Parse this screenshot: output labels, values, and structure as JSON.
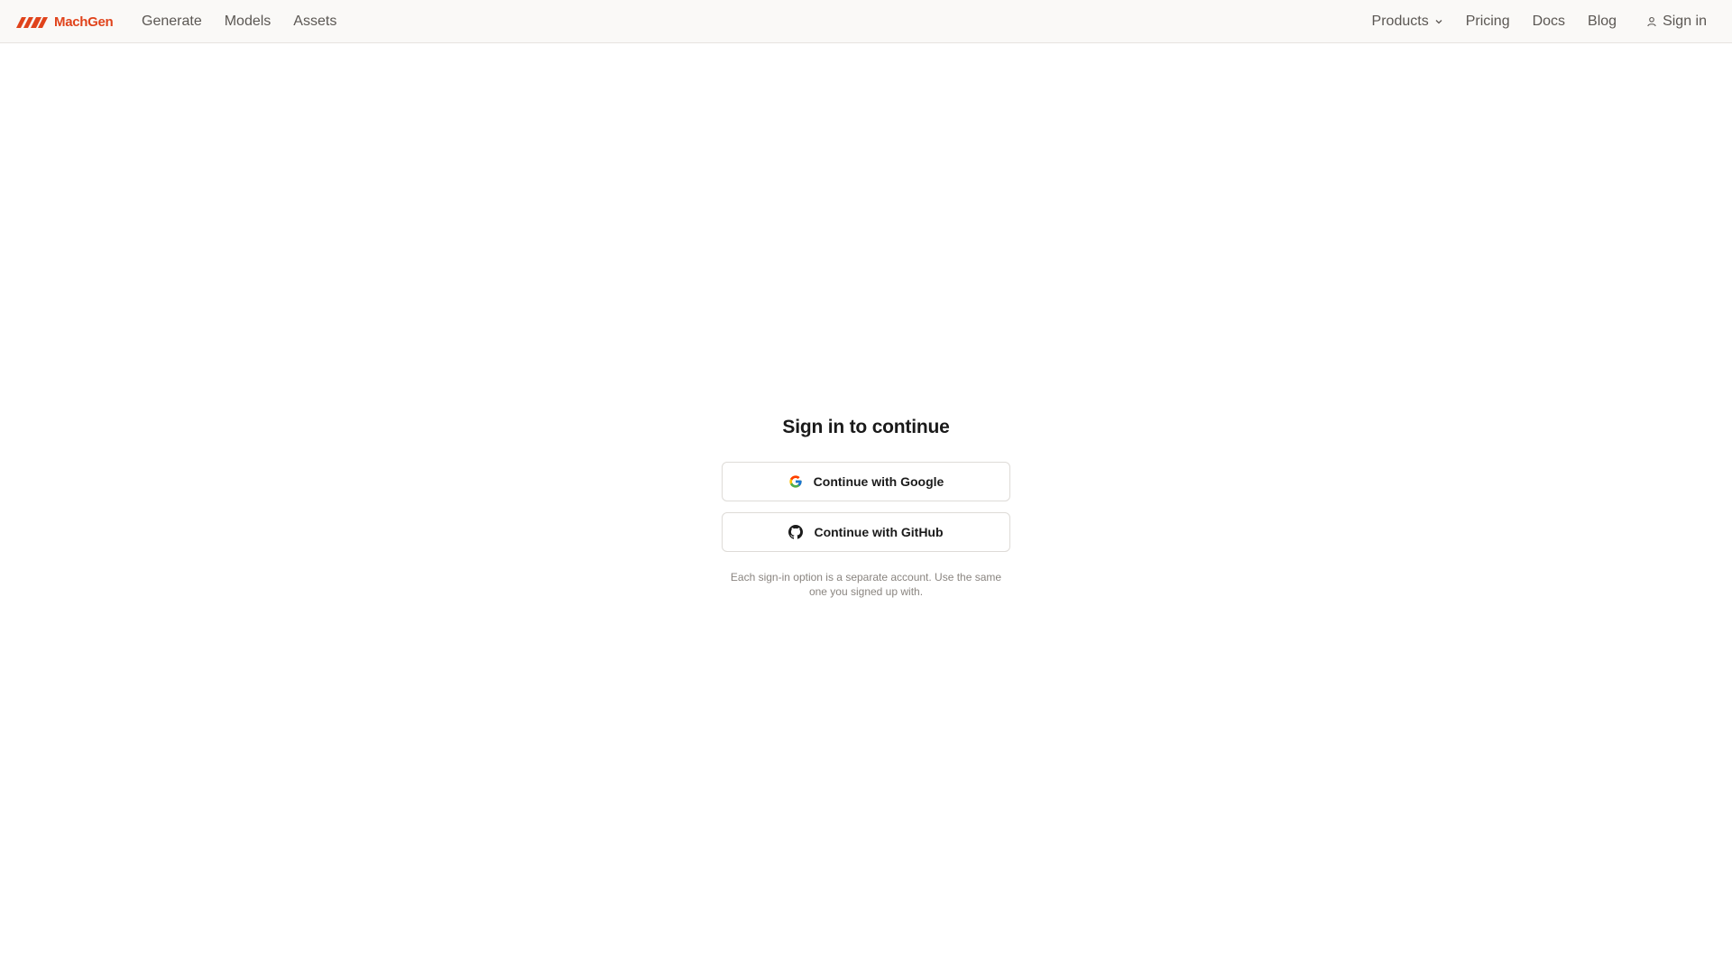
{
  "brand": {
    "name": "MachGen",
    "color": "#e0431b"
  },
  "nav": {
    "left": [
      {
        "label": "Generate"
      },
      {
        "label": "Models"
      },
      {
        "label": "Assets"
      }
    ],
    "right": {
      "products": "Products",
      "pricing": "Pricing",
      "docs": "Docs",
      "blog": "Blog",
      "signin": "Sign in"
    }
  },
  "signin": {
    "title": "Sign in to continue",
    "google_button": "Continue with Google",
    "github_button": "Continue with GitHub",
    "note": "Each sign-in option is a separate account. Use the same one you signed up with."
  },
  "icons": {
    "logo": "machgen-logo-icon",
    "chevron": "chevron-down-icon",
    "user": "user-icon",
    "google": "google-icon",
    "github": "github-icon"
  }
}
